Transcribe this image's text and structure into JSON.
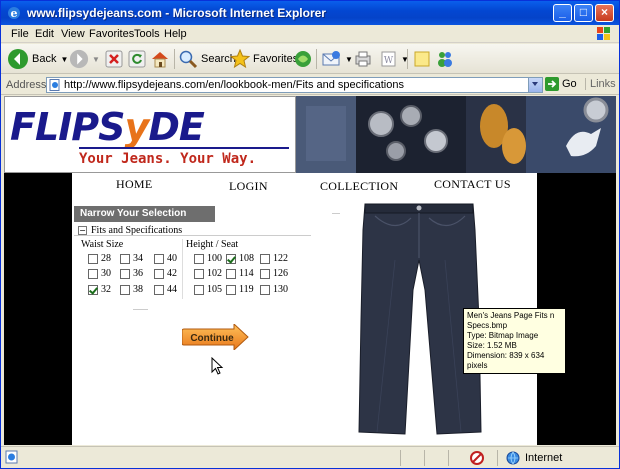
{
  "window": {
    "title": "www.flipsydejeans.com - Microsoft Internet Explorer",
    "minimize": "_",
    "maximize": "□",
    "close": "×"
  },
  "menu": [
    "File",
    "Edit",
    "View",
    "Favorites",
    "Tools",
    "Help"
  ],
  "toolbar": {
    "back": "Back",
    "search": "Search",
    "favorites": "Favorites"
  },
  "address": {
    "label": "Address",
    "url": "http://www.flipsydejeans.com/en/lookbook-men/Fits and specifications",
    "go": "Go",
    "links": "Links"
  },
  "site": {
    "logo_main_1": "FLIPS",
    "logo_y": "y",
    "logo_main_2": "DE",
    "tagline": "Your Jeans. Your Way.",
    "nav": {
      "home": "HOME",
      "login": "LOGIN",
      "collection": "COLLECTION",
      "contact": "CONTACT US"
    },
    "filter": {
      "header": "Narrow Your Selection",
      "section": "Fits and Specifications",
      "toggle": "−",
      "waist_label": "Waist Size",
      "height_label": "Height / Seat",
      "waist_sizes": [
        {
          "label": "28",
          "checked": false
        },
        {
          "label": "34",
          "checked": false
        },
        {
          "label": "40",
          "checked": false
        },
        {
          "label": "30",
          "checked": false
        },
        {
          "label": "36",
          "checked": false
        },
        {
          "label": "42",
          "checked": false
        },
        {
          "label": "32",
          "checked": true
        },
        {
          "label": "38",
          "checked": false
        },
        {
          "label": "44",
          "checked": false
        }
      ],
      "heights": [
        {
          "label": "100",
          "checked": false
        },
        {
          "label": "108",
          "checked": true
        },
        {
          "label": "122",
          "checked": false
        },
        {
          "label": "102",
          "checked": false
        },
        {
          "label": "114",
          "checked": false
        },
        {
          "label": "126",
          "checked": false
        },
        {
          "label": "105",
          "checked": false
        },
        {
          "label": "119",
          "checked": false
        },
        {
          "label": "130",
          "checked": false
        }
      ]
    },
    "continue": "Continue",
    "tooltip": {
      "line1": "Men's Jeans Page Fits n Specs.bmp",
      "line2": "Type: Bitmap Image",
      "line3": "Size: 1.52 MB",
      "line4": "Dimension: 839 x 634 pixels"
    }
  },
  "status": {
    "zone": "Internet"
  },
  "colors": {
    "title_blue": "#0347d2",
    "logo_blue": "#1a1a8c",
    "logo_orange": "#e8731a",
    "tagline_red": "#c0281c",
    "continue_orange": "#f08a1c",
    "denim": "#2d3446"
  }
}
